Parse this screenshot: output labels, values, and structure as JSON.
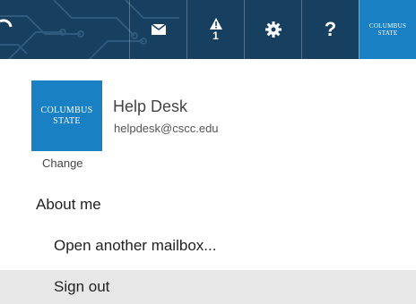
{
  "topbar": {
    "alert_count": "1",
    "help_symbol": "?",
    "brand": {
      "line1": "COLUMBUS",
      "line2": "STATE"
    },
    "icons": [
      "mail-icon",
      "alert-icon",
      "gear-icon",
      "help-icon"
    ]
  },
  "profile": {
    "logo": {
      "line1": "COLUMBUS",
      "line2": "STATE"
    },
    "change_label": "Change",
    "name": "Help Desk",
    "email": "helpdesk@cscc.edu"
  },
  "menu": {
    "about_me": "About me",
    "open_mailbox": "Open another mailbox...",
    "sign_out": "Sign out"
  },
  "colors": {
    "topbar_bg": "#173f5f",
    "brand_blue": "#1a80c4",
    "hover_bg": "#e7e7e7"
  }
}
